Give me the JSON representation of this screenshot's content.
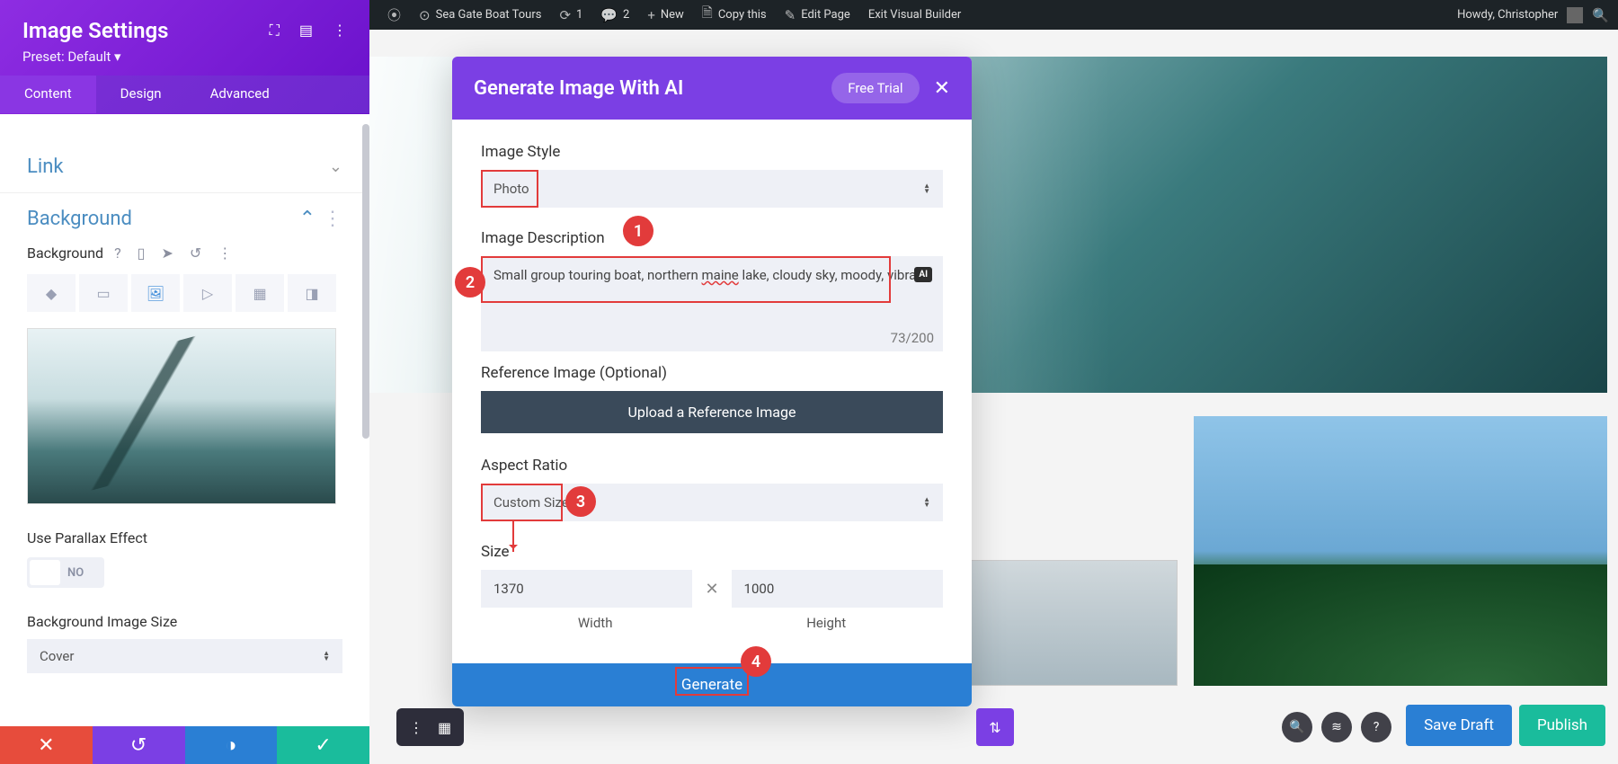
{
  "adminbar": {
    "site": "Sea Gate Boat Tours",
    "refresh": "1",
    "comments": "2",
    "new": "New",
    "copy": "Copy this",
    "edit": "Edit Page",
    "exit": "Exit Visual Builder",
    "howdy": "Howdy, Christopher"
  },
  "sidebar": {
    "title": "Image Settings",
    "preset": "Preset: Default ▾",
    "tabs": {
      "content": "Content",
      "design": "Design",
      "advanced": "Advanced"
    },
    "sections": {
      "link": "Link",
      "background": "Background",
      "bg_label": "Background",
      "parallax": "Use Parallax Effect",
      "parallax_val": "NO",
      "bgsize": "Background Image Size",
      "bgsize_val": "Cover"
    }
  },
  "modal": {
    "title": "Generate Image With AI",
    "trial": "Free Trial",
    "style_label": "Image Style",
    "style_val": "Photo",
    "desc_label": "Image Description",
    "desc_val_pre": "Small group touring boat, northern ",
    "desc_val_err": "maine",
    "desc_val_post": " lake, cloudy sky, moody, vibrant",
    "count": "73/200",
    "ref_label": "Reference Image (Optional)",
    "upload": "Upload a Reference Image",
    "aspect_label": "Aspect Ratio",
    "aspect_val": "Custom Size",
    "size_label": "Size",
    "width": "1370",
    "width_label": "Width",
    "height": "1000",
    "height_label": "Height",
    "generate": "Generate"
  },
  "actions": {
    "save": "Save Draft",
    "publish": "Publish"
  },
  "steps": {
    "s1": "1",
    "s2": "2",
    "s3": "3",
    "s4": "4"
  }
}
